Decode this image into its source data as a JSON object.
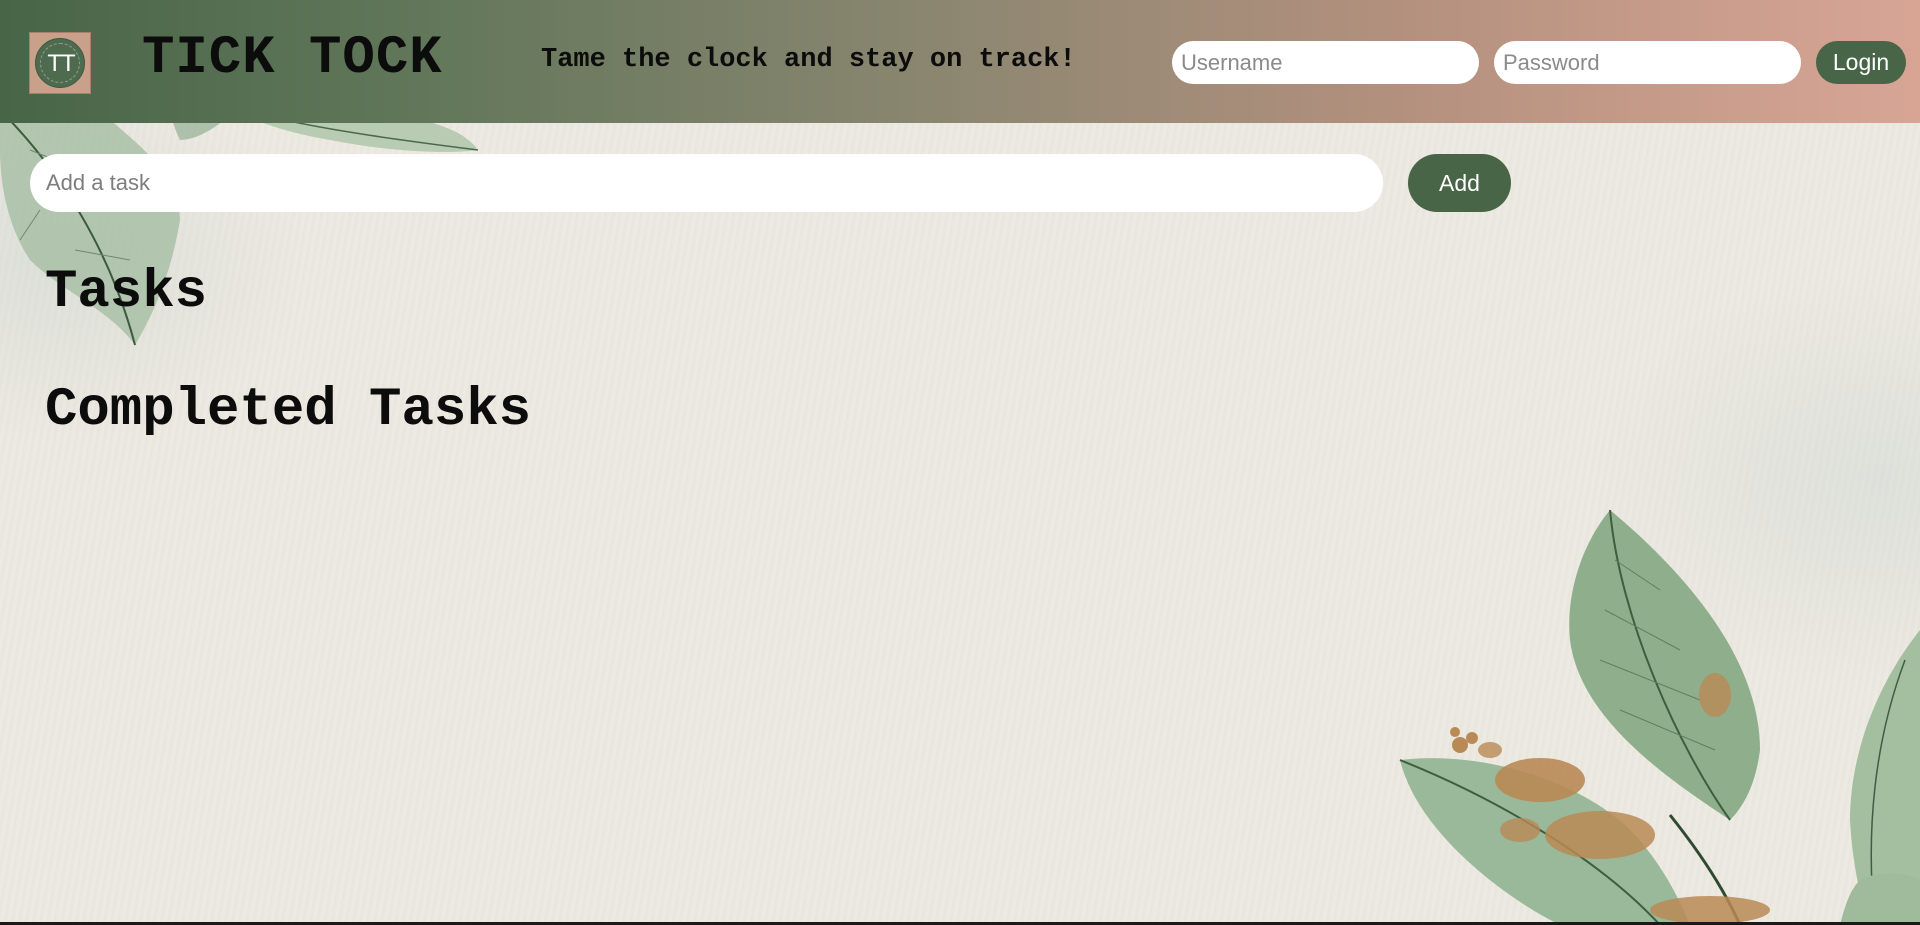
{
  "header": {
    "logo_text": "TT",
    "title": "TICK TOCK",
    "tagline": "Tame the clock and stay on track!",
    "username_placeholder": "Username",
    "password_placeholder": "Password",
    "login_label": "Login"
  },
  "task_entry": {
    "placeholder": "Add a task",
    "add_label": "Add"
  },
  "tasks": {
    "heading": "Tasks",
    "items": []
  },
  "completed": {
    "heading": "Completed Tasks",
    "items": []
  },
  "colors": {
    "accent_green": "#486548",
    "header_gradient_start": "#486548",
    "header_gradient_end": "#d8a595",
    "page_background": "#ebe8e0",
    "logo_background": "#c9a08a"
  },
  "icons": [
    "leaf-decoration-icon",
    "gold-leaf-flecks-icon"
  ]
}
